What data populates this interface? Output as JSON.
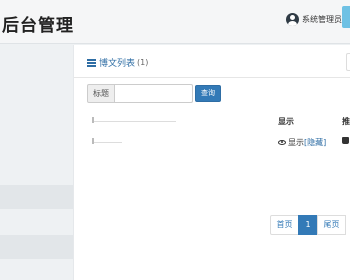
{
  "header": {
    "brand": "后台管理",
    "user_name": "系统管理员",
    "user_icon": "user-circle-icon"
  },
  "panel": {
    "title": "博文列表",
    "count": "(1)",
    "title_icon": "list-icon"
  },
  "search": {
    "label": "标题",
    "value": "",
    "button": "查询"
  },
  "table": {
    "columns": [
      "显示",
      "推"
    ],
    "rows": [
      {
        "show_label": "显示",
        "hide_link": "[隐藏]"
      }
    ]
  },
  "pagination": {
    "first": "首页",
    "current": "1",
    "last": "尾页"
  },
  "colors": {
    "accent": "#337ab7",
    "topbar": "#f5f6f7",
    "sidebar": "#eef1f3"
  }
}
